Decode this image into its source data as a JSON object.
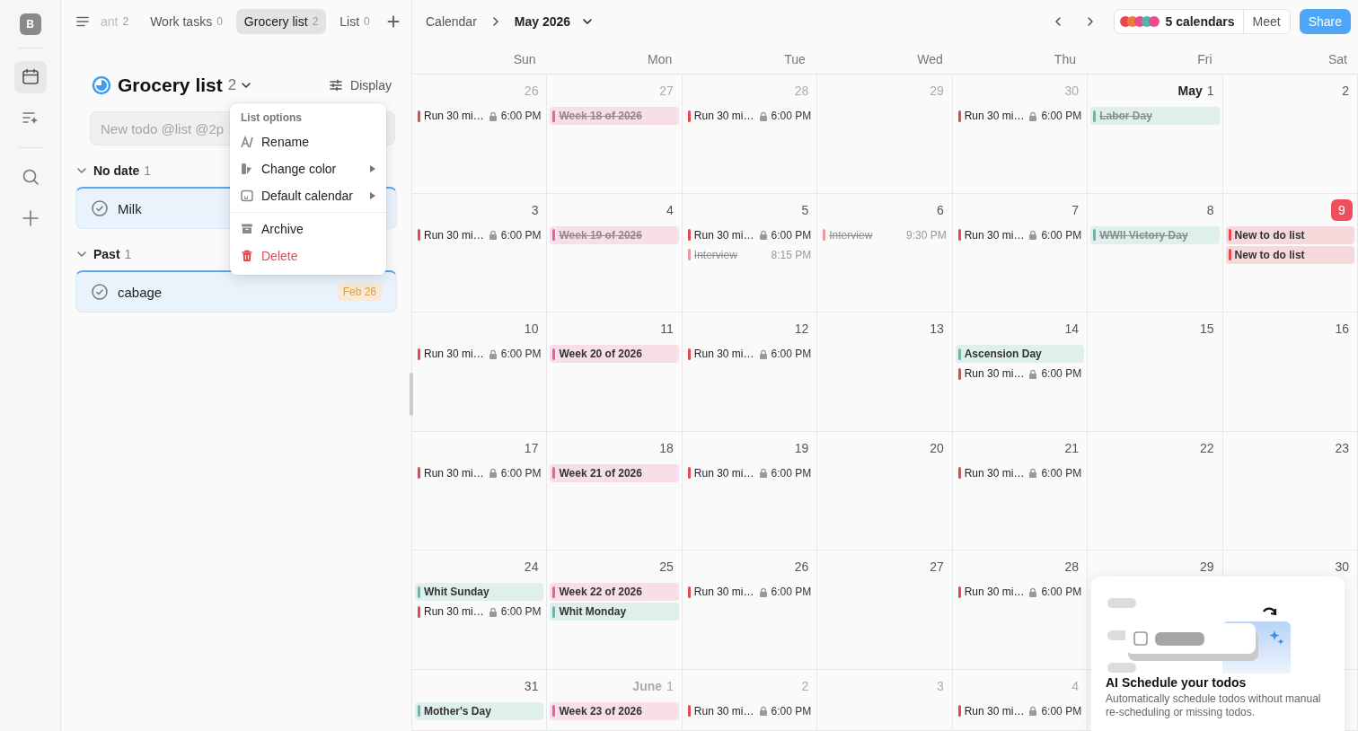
{
  "rail": {
    "avatar": "B",
    "items": [
      {
        "kind": "calendar",
        "selected": true
      },
      {
        "kind": "ai",
        "selected": false
      },
      {
        "kind": "search",
        "selected": false
      },
      {
        "kind": "add",
        "selected": false
      }
    ]
  },
  "tabs": [
    {
      "label": "ant",
      "count": "2",
      "selected": false,
      "faded": true
    },
    {
      "label": "Work tasks",
      "count": "0",
      "selected": false,
      "faded": false
    },
    {
      "label": "Grocery list",
      "count": "2",
      "selected": true,
      "faded": false
    },
    {
      "label": "List",
      "count": "0",
      "selected": false,
      "faded": false
    }
  ],
  "list": {
    "title": "Grocery list",
    "count": "2",
    "display_button": "Display",
    "new_todo": {
      "placeholder": "New todo @list @2p"
    },
    "groups": [
      {
        "label": "No date",
        "count": "1",
        "expanded": true,
        "todos": [
          {
            "title": "Milk",
            "done": false
          }
        ]
      },
      {
        "label": "Past",
        "count": "1",
        "expanded": true,
        "todos": [
          {
            "title": "cabage",
            "done": false,
            "date": "Feb 26"
          }
        ]
      }
    ]
  },
  "list_menu": {
    "header": "List options",
    "items": [
      {
        "kind": "rename",
        "label": "Rename",
        "submenu": false,
        "danger": false
      },
      {
        "kind": "color",
        "label": "Change color",
        "submenu": true,
        "danger": false
      },
      {
        "kind": "calendar",
        "label": "Default calendar",
        "submenu": true,
        "danger": false
      },
      {
        "kind": "archive",
        "label": "Archive",
        "submenu": false,
        "danger": false,
        "divider_before": true
      },
      {
        "kind": "delete",
        "label": "Delete",
        "submenu": false,
        "danger": true
      }
    ]
  },
  "calendar_header": {
    "breadcrumb": "Calendar",
    "month": "May 2026",
    "calendars": {
      "label": "5 calendars",
      "dots": [
        {
          "color": "#e5484d"
        },
        {
          "color": "#f07a3a"
        },
        {
          "color": "#e84f8f"
        },
        {
          "color": "#4fb8a6"
        },
        {
          "color": "#e84f8f"
        }
      ]
    },
    "meet_button": "Meet",
    "share_button": "Share"
  },
  "weekdays": [
    "Sun",
    "Mon",
    "Tue",
    "Wed",
    "Thu",
    "Fri",
    "Sat"
  ],
  "weeks": [
    {
      "days": [
        {
          "date": "26",
          "muted": true,
          "today": false,
          "events": [
            {
              "kind": "timed",
              "title": "Run 30 mi…",
              "time": "6:00 PM",
              "locked": true,
              "done": false,
              "color": "#e5484d"
            }
          ]
        },
        {
          "date": "27",
          "muted": true,
          "today": false,
          "events": [
            {
              "kind": "allday",
              "title": "Week 18 of 2026",
              "done": true,
              "color": "#e8609c"
            }
          ]
        },
        {
          "date": "28",
          "muted": true,
          "today": false,
          "events": [
            {
              "kind": "timed",
              "title": "Run 30 mi…",
              "time": "6:00 PM",
              "locked": true,
              "done": false,
              "color": "#e5484d"
            }
          ]
        },
        {
          "date": "29",
          "muted": true,
          "today": false
        },
        {
          "date": "30",
          "muted": true,
          "today": false,
          "events": [
            {
              "kind": "timed",
              "title": "Run 30 mi…",
              "time": "6:00 PM",
              "locked": true,
              "done": false,
              "color": "#e5484d"
            }
          ]
        },
        {
          "date": "1",
          "month_label": "May",
          "muted": false,
          "today": false,
          "events": [
            {
              "kind": "allday",
              "title": "Labor Day",
              "done": true,
              "color": "#5cbfae"
            }
          ]
        },
        {
          "date": "2",
          "muted": false,
          "today": false
        }
      ]
    },
    {
      "days": [
        {
          "date": "3",
          "muted": false,
          "today": false,
          "events": [
            {
              "kind": "timed",
              "title": "Run 30 mi…",
              "time": "6:00 PM",
              "locked": true,
              "done": false,
              "color": "#e5484d"
            }
          ]
        },
        {
          "date": "4",
          "muted": false,
          "today": false,
          "events": [
            {
              "kind": "allday",
              "title": "Week 19 of 2026",
              "done": true,
              "color": "#e8609c"
            }
          ]
        },
        {
          "date": "5",
          "muted": false,
          "today": false,
          "events": [
            {
              "kind": "timed",
              "title": "Run 30 mi…",
              "time": "6:00 PM",
              "locked": true,
              "done": false,
              "color": "#e5484d"
            },
            {
              "kind": "timed",
              "title": "Interview",
              "time": "8:15 PM",
              "locked": false,
              "done": true,
              "color": "#f0989b"
            }
          ]
        },
        {
          "date": "6",
          "muted": false,
          "today": false,
          "events": [
            {
              "kind": "timed",
              "title": "Interview",
              "time": "9:30 PM",
              "locked": false,
              "done": true,
              "color": "#f0989b"
            }
          ]
        },
        {
          "date": "7",
          "muted": false,
          "today": false,
          "events": [
            {
              "kind": "timed",
              "title": "Run 30 mi…",
              "time": "6:00 PM",
              "locked": true,
              "done": false,
              "color": "#e5484d"
            }
          ]
        },
        {
          "date": "8",
          "muted": false,
          "today": false,
          "events": [
            {
              "kind": "allday",
              "title": "WWII Victory Day",
              "done": true,
              "color": "#5cbfae"
            }
          ]
        },
        {
          "date": "9",
          "muted": false,
          "today": true,
          "events": [
            {
              "kind": "allday",
              "title": "New to do list",
              "done": false,
              "color": "#e5484d"
            },
            {
              "kind": "allday",
              "title": "New to do list",
              "done": false,
              "color": "#e5484d"
            }
          ]
        }
      ]
    },
    {
      "days": [
        {
          "date": "10",
          "muted": false,
          "today": false,
          "events": [
            {
              "kind": "timed",
              "title": "Run 30 mi…",
              "time": "6:00 PM",
              "locked": true,
              "done": false,
              "color": "#e5484d"
            }
          ]
        },
        {
          "date": "11",
          "muted": false,
          "today": false,
          "events": [
            {
              "kind": "allday",
              "title": "Week 20 of 2026",
              "done": false,
              "color": "#e8609c"
            }
          ]
        },
        {
          "date": "12",
          "muted": false,
          "today": false,
          "events": [
            {
              "kind": "timed",
              "title": "Run 30 mi…",
              "time": "6:00 PM",
              "locked": true,
              "done": false,
              "color": "#e5484d"
            }
          ]
        },
        {
          "date": "13",
          "muted": false,
          "today": false
        },
        {
          "date": "14",
          "muted": false,
          "today": false,
          "events": [
            {
              "kind": "allday",
              "title": "Ascension Day",
              "done": false,
              "color": "#5cbfae"
            },
            {
              "kind": "timed",
              "title": "Run 30 mi…",
              "time": "6:00 PM",
              "locked": true,
              "done": false,
              "color": "#e5484d"
            }
          ]
        },
        {
          "date": "15",
          "muted": false,
          "today": false
        },
        {
          "date": "16",
          "muted": false,
          "today": false
        }
      ]
    },
    {
      "days": [
        {
          "date": "17",
          "muted": false,
          "today": false,
          "events": [
            {
              "kind": "timed",
              "title": "Run 30 mi…",
              "time": "6:00 PM",
              "locked": true,
              "done": false,
              "color": "#e5484d"
            }
          ]
        },
        {
          "date": "18",
          "muted": false,
          "today": false,
          "events": [
            {
              "kind": "allday",
              "title": "Week 21 of 2026",
              "done": false,
              "color": "#e8609c"
            }
          ]
        },
        {
          "date": "19",
          "muted": false,
          "today": false,
          "events": [
            {
              "kind": "timed",
              "title": "Run 30 mi…",
              "time": "6:00 PM",
              "locked": true,
              "done": false,
              "color": "#e5484d"
            }
          ]
        },
        {
          "date": "20",
          "muted": false,
          "today": false
        },
        {
          "date": "21",
          "muted": false,
          "today": false,
          "events": [
            {
              "kind": "timed",
              "title": "Run 30 mi…",
              "time": "6:00 PM",
              "locked": true,
              "done": false,
              "color": "#e5484d"
            }
          ]
        },
        {
          "date": "22",
          "muted": false,
          "today": false
        },
        {
          "date": "23",
          "muted": false,
          "today": false
        }
      ]
    },
    {
      "days": [
        {
          "date": "24",
          "muted": false,
          "today": false,
          "events": [
            {
              "kind": "allday",
              "title": "Whit Sunday",
              "done": false,
              "color": "#5cbfae"
            },
            {
              "kind": "timed",
              "title": "Run 30 mi…",
              "time": "6:00 PM",
              "locked": true,
              "done": false,
              "color": "#e5484d"
            }
          ]
        },
        {
          "date": "25",
          "muted": false,
          "today": false,
          "events": [
            {
              "kind": "allday",
              "title": "Week 22 of 2026",
              "done": false,
              "color": "#e8609c"
            },
            {
              "kind": "allday",
              "title": "Whit Monday",
              "done": false,
              "color": "#5cbfae"
            }
          ]
        },
        {
          "date": "26",
          "muted": false,
          "today": false,
          "events": [
            {
              "kind": "timed",
              "title": "Run 30 mi…",
              "time": "6:00 PM",
              "locked": true,
              "done": false,
              "color": "#e5484d"
            }
          ]
        },
        {
          "date": "27",
          "muted": false,
          "today": false
        },
        {
          "date": "28",
          "muted": false,
          "today": false,
          "events": [
            {
              "kind": "timed",
              "title": "Run 30 mi…",
              "time": "6:00 PM",
              "locked": true,
              "done": false,
              "color": "#e5484d"
            }
          ]
        },
        {
          "date": "29",
          "muted": false,
          "today": false
        },
        {
          "date": "30",
          "muted": false,
          "today": false
        }
      ]
    },
    {
      "days": [
        {
          "date": "31",
          "muted": false,
          "today": false,
          "events": [
            {
              "kind": "allday",
              "title": "Mother's Day",
              "done": false,
              "color": "#5cbfae"
            }
          ]
        },
        {
          "date": "1",
          "month_label": "June",
          "muted": true,
          "today": false,
          "events": [
            {
              "kind": "allday",
              "title": "Week 23 of 2026",
              "done": false,
              "color": "#e8609c"
            }
          ]
        },
        {
          "date": "2",
          "muted": true,
          "today": false,
          "events": [
            {
              "kind": "timed",
              "title": "Run 30 mi…",
              "time": "6:00 PM",
              "locked": true,
              "done": false,
              "color": "#e5484d"
            }
          ]
        },
        {
          "date": "3",
          "muted": true,
          "today": false
        },
        {
          "date": "4",
          "muted": true,
          "today": false,
          "events": [
            {
              "kind": "timed",
              "title": "Run 30 mi…",
              "time": "6:00 PM",
              "locked": true,
              "done": false,
              "color": "#e5484d"
            }
          ]
        }
      ]
    }
  ],
  "promo": {
    "title": "AI Schedule your todos",
    "description": "Automatically schedule todos without manual re-scheduling or missing todos."
  }
}
